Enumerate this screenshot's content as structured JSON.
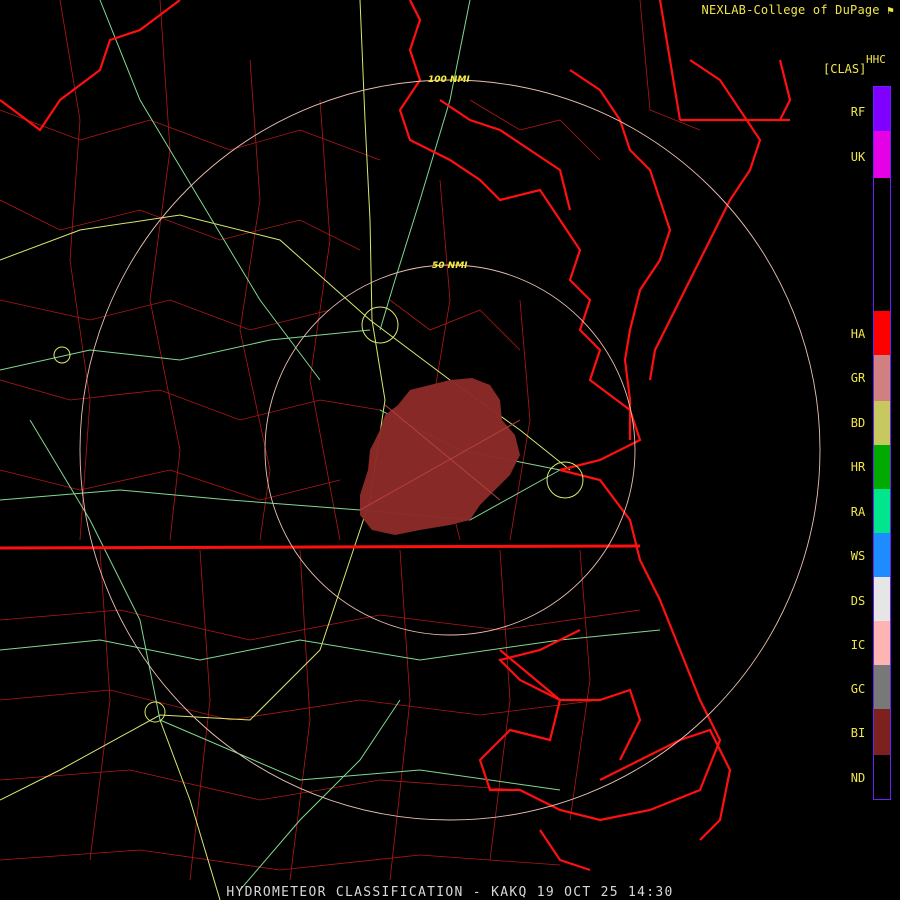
{
  "header": {
    "credit": "NEXLAB-College of DuPage",
    "product_code": "HHC",
    "unit": "[CLAS]"
  },
  "footer": {
    "title": "HYDROMETEOR CLASSIFICATION - KAKQ 19 OCT 25 14:30"
  },
  "range_rings": [
    {
      "label": "100 NMI"
    },
    {
      "label": "50 NMI"
    }
  ],
  "legend": [
    {
      "code": "RF",
      "color": "#7f00ff"
    },
    {
      "code": "UK",
      "color": "#e600e6"
    },
    {
      "code": "HA",
      "color": "#ff0000"
    },
    {
      "code": "GR",
      "color": "#d08080"
    },
    {
      "code": "BD",
      "color": "#c8c860"
    },
    {
      "code": "HR",
      "color": "#00aa00"
    },
    {
      "code": "RA",
      "color": "#00e68c"
    },
    {
      "code": "WS",
      "color": "#1e8cff"
    },
    {
      "code": "DS",
      "color": "#e6e6e6"
    },
    {
      "code": "IC",
      "color": "#ffb4b4"
    },
    {
      "code": "GC",
      "color": "#787878"
    },
    {
      "code": "BI",
      "color": "#7c2020"
    },
    {
      "code": "ND",
      "color": "#000000"
    }
  ],
  "colors": {
    "state_border": "#ff1010",
    "county_line": "#b01818",
    "highway_primary": "#d8e870",
    "highway_secondary": "#80d890",
    "range_ring": "#e8c0b0",
    "echo": "#8a2a28"
  }
}
